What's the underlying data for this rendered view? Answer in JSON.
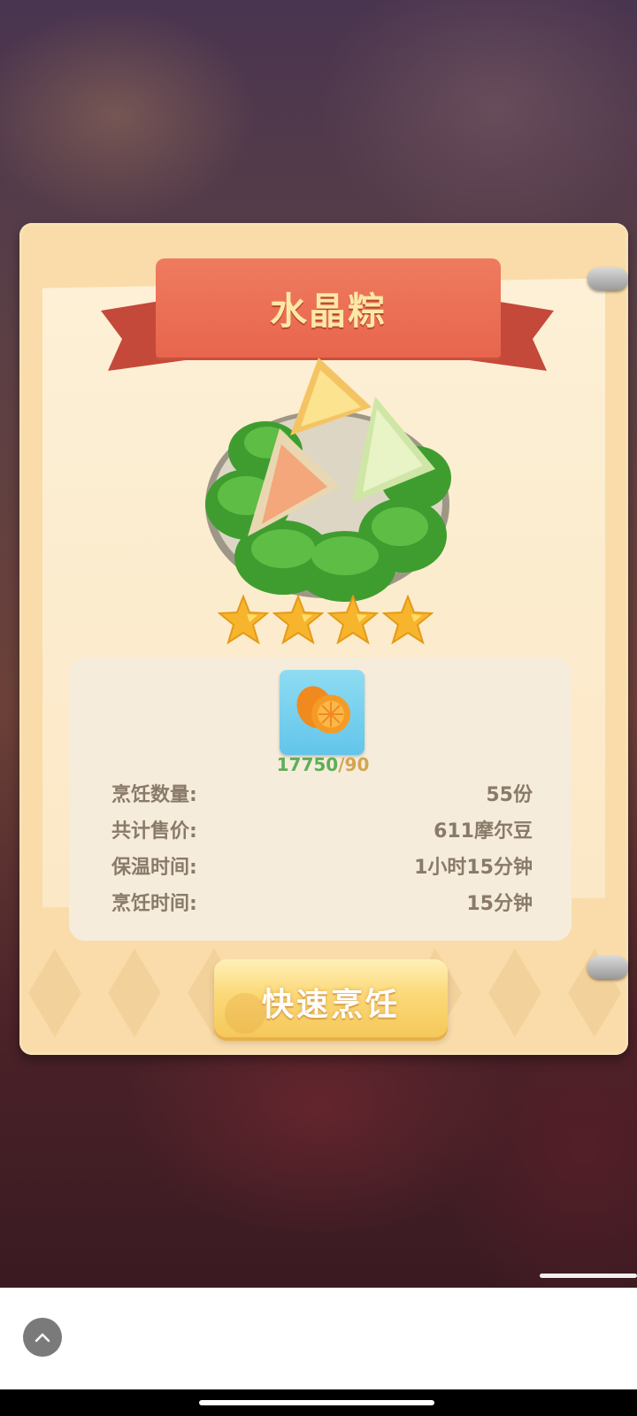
{
  "dish": {
    "title": "水晶粽",
    "stars": 4,
    "max_stars": 4
  },
  "ingredient": {
    "icon": "tangerine-icon",
    "have": "17750",
    "need": "90",
    "separator": "/"
  },
  "info": [
    {
      "label": "烹饪数量:",
      "value": "55份"
    },
    {
      "label": "共计售价:",
      "value": "611摩尔豆"
    },
    {
      "label": "保温时间:",
      "value": "1小时15分钟"
    },
    {
      "label": "烹饪时间:",
      "value": "15分钟"
    }
  ],
  "actions": {
    "quick_cook_label": "快速烹饪"
  },
  "colors": {
    "ribbon": "#e8654d",
    "title_text": "#fde8a6",
    "card": "#f9dcaa",
    "count_have": "#5fae55",
    "count_need": "#d4a451",
    "button": "#fbd978"
  }
}
